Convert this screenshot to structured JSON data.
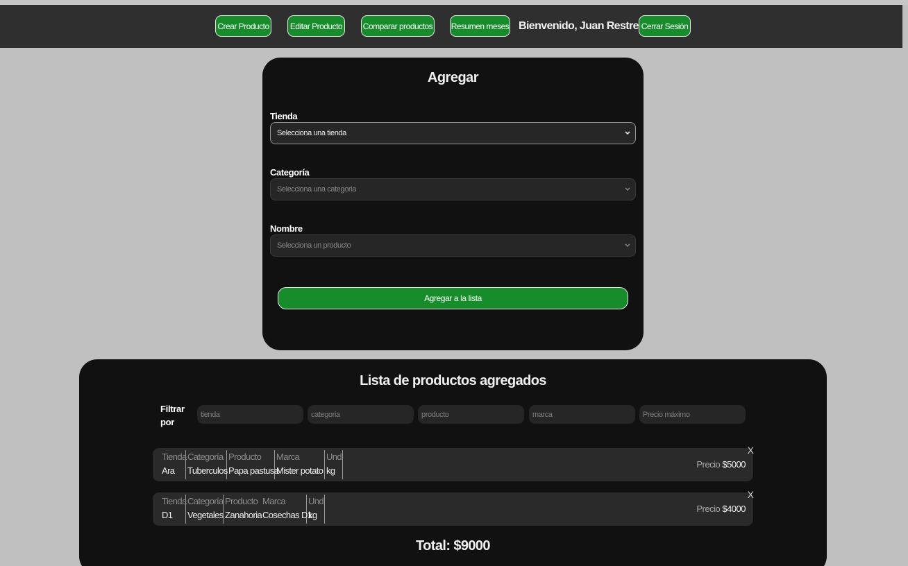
{
  "nav": {
    "buttons": [
      "Crear Producto",
      "Editar Producto",
      "Comparar productos",
      "Resumen meses"
    ],
    "welcome": "Bienvenido, Juan Restrepo",
    "logout": "Cerrar Sesión"
  },
  "form": {
    "title": "Agregar",
    "tienda_label": "Tienda",
    "tienda_value": "Selecciona una tienda",
    "categoria_label": "Categoría",
    "categoria_value": "Selecciona una categoria",
    "nombre_label": "Nombre",
    "nombre_value": "Selecciona un producto",
    "submit": "Agregar a la lista"
  },
  "list": {
    "title": "Lista de productos agregados",
    "filter_label": "Filtrar por",
    "filters": [
      "tienda",
      "categoria",
      "producto",
      "marca",
      "Precio máximo"
    ],
    "headers": {
      "tienda": "Tienda",
      "categoria": "Categoría",
      "producto": "Producto",
      "marca": "Marca",
      "und": "Und",
      "precio": "Precio"
    },
    "rows": [
      {
        "tienda": "Ara",
        "categoria": "Tuberculos",
        "producto": "Papa pastusa",
        "marca": "Mister potato",
        "und": "kg",
        "precio": "$5000",
        "close": "X"
      },
      {
        "tienda": "D1",
        "categoria": "Vegetales",
        "producto": "Zanahoria",
        "marca": "Cosechas D1",
        "und": "kg",
        "precio": "$4000",
        "close": "X"
      }
    ],
    "total": "Total: $9000"
  },
  "colors": {
    "accent_green": "#168c2a",
    "card_bg": "#111111",
    "navbar_bg": "#2f2f2f",
    "page_bg": "#c0c0c0"
  }
}
